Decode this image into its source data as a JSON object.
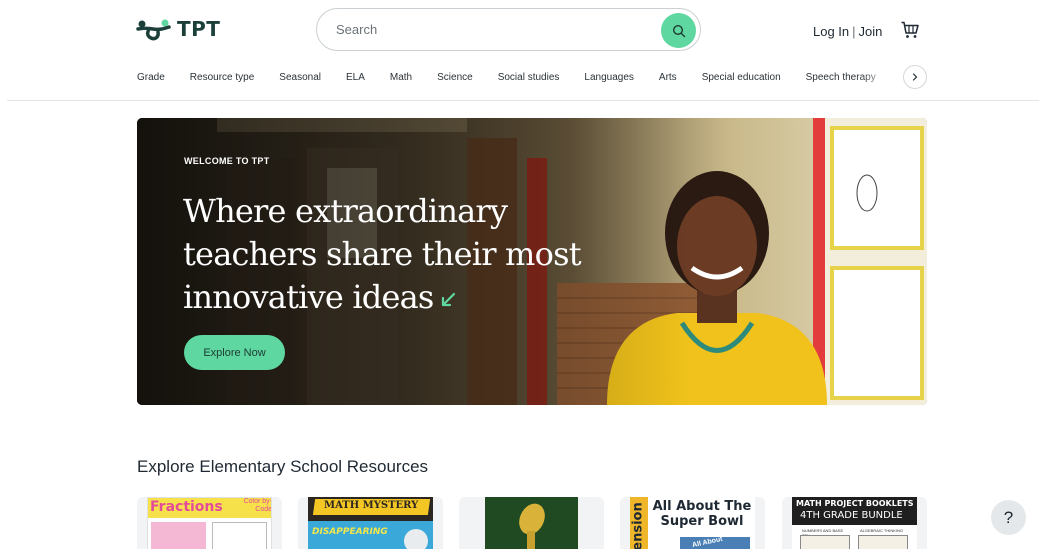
{
  "header": {
    "logo_text": "TPT",
    "search_placeholder": "Search",
    "login_label": "Log In",
    "separator": "|",
    "join_label": "Join"
  },
  "nav": {
    "items": [
      "Grade",
      "Resource type",
      "Seasonal",
      "ELA",
      "Math",
      "Science",
      "Social studies",
      "Languages",
      "Arts",
      "Special education",
      "Speech therapy"
    ]
  },
  "hero": {
    "eyebrow": "WELCOME TO TPT",
    "title": "Where extraordinary teachers share their most innovative ideas",
    "cta_label": "Explore Now"
  },
  "section": {
    "title": "Explore Elementary School Resources"
  },
  "cards": [
    {
      "title": "Fractions",
      "badge": "Color by-Code"
    },
    {
      "title": "MATH MYSTERY",
      "subtitle": "DISAPPEARING"
    },
    {
      "title": ""
    },
    {
      "title": "All About The Super Bowl",
      "side_label": "ension",
      "inset_text": "All About"
    },
    {
      "title": "MATH PROJECT BOOKLETS",
      "subtitle": "4TH GRADE BUNDLE",
      "caption1": "NUMBERS AND BASE TEN",
      "caption2": "ALGEBRAIC THINKING"
    }
  ],
  "help": {
    "label": "?"
  },
  "colors": {
    "accent": "#5ed7a0",
    "brand_dark": "#1c3f3a"
  },
  "icons": [
    "tpt-logo-icon",
    "search-icon",
    "cart-icon",
    "chevron-right-icon",
    "arrow-down-left-icon",
    "help-icon"
  ]
}
